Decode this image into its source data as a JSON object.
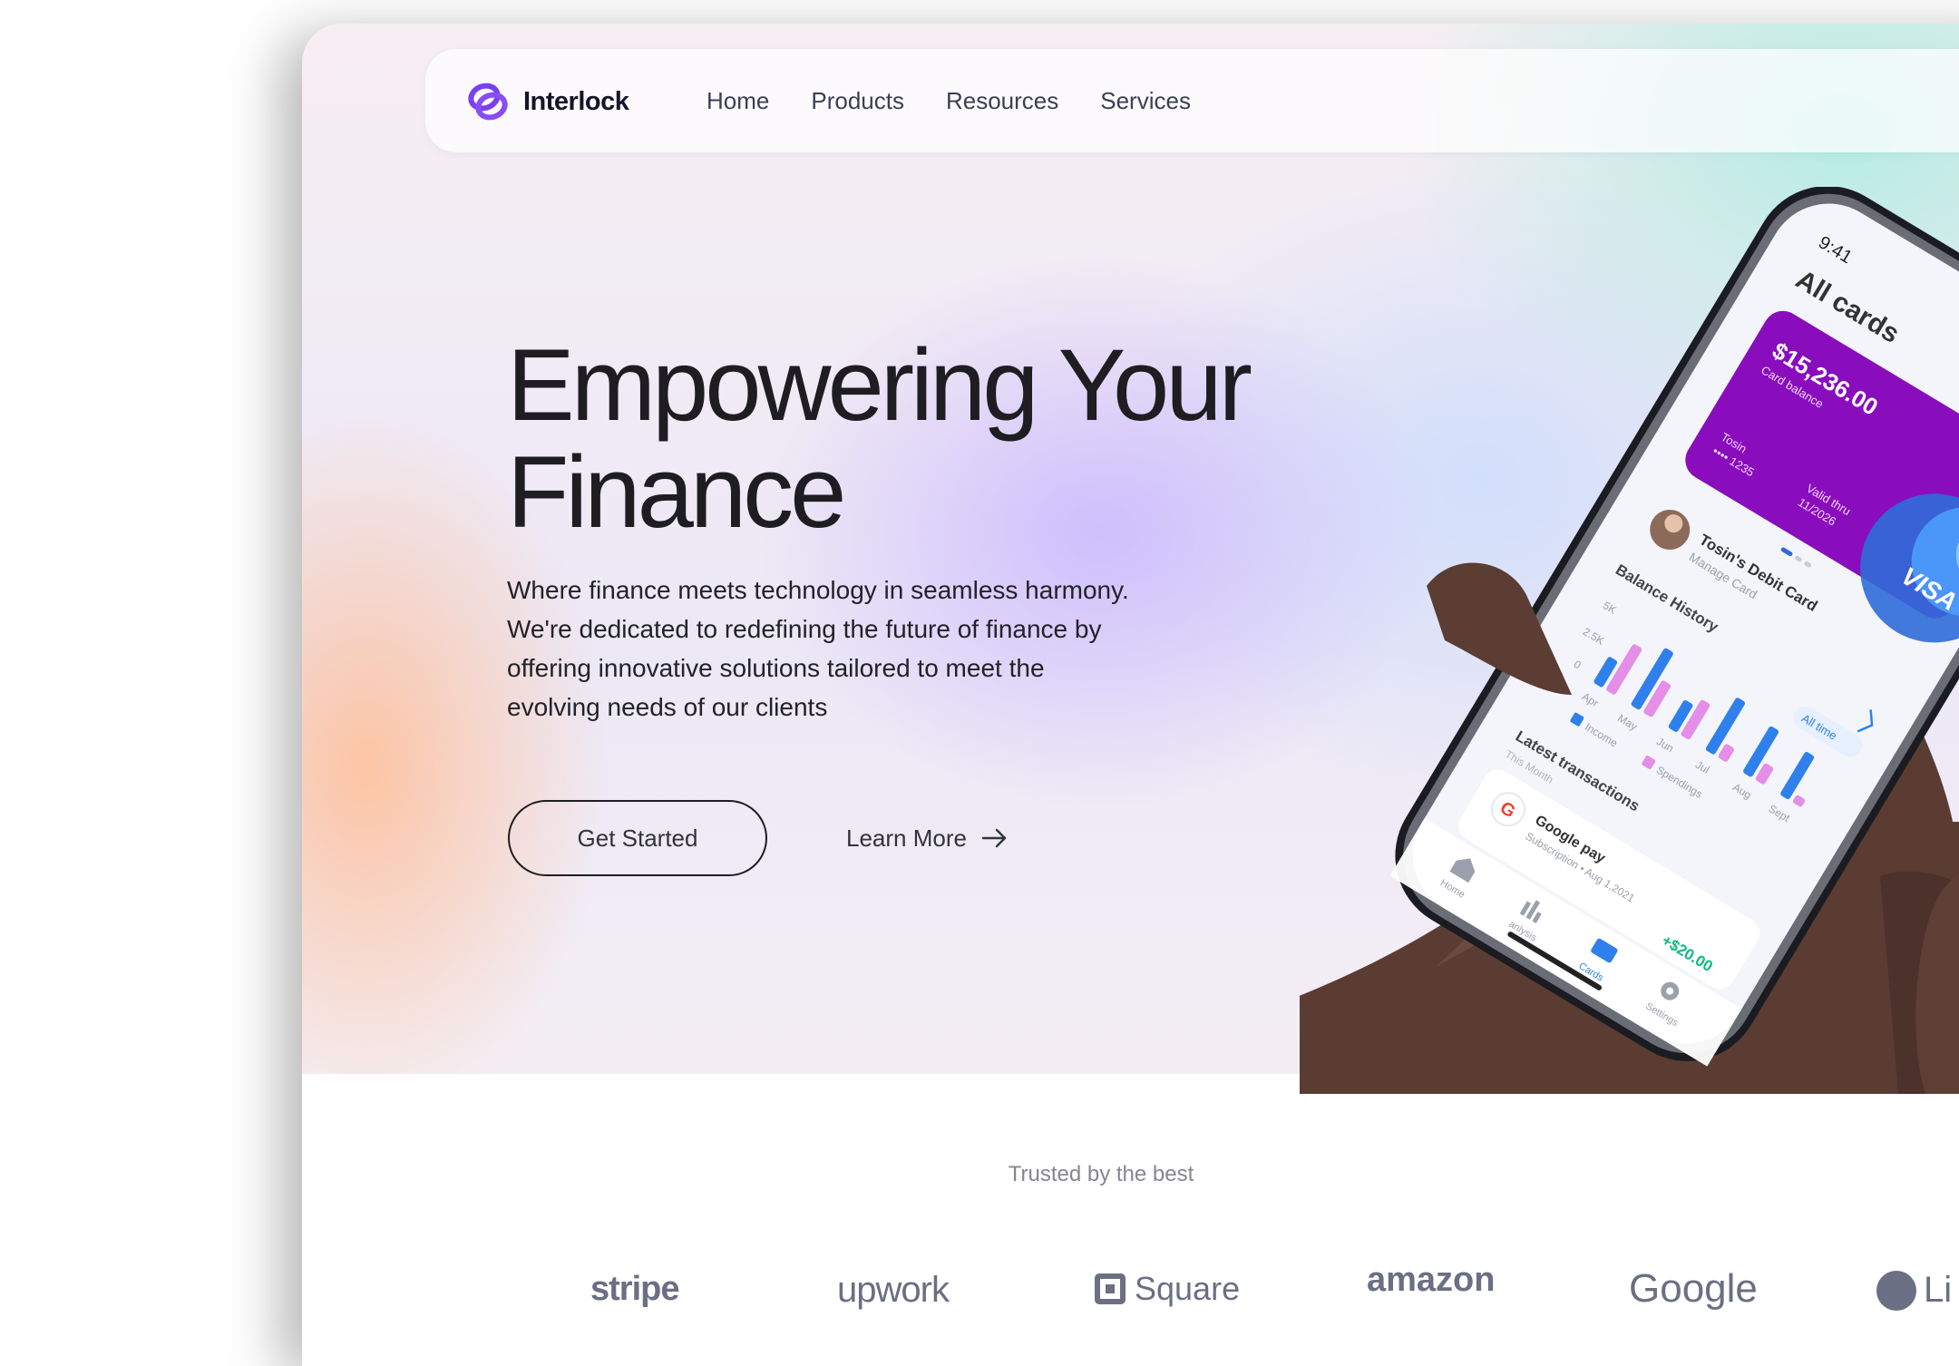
{
  "brand": {
    "name": "Interlock",
    "accent": "#7b3ff2"
  },
  "nav": {
    "links": [
      "Home",
      "Products",
      "Resources",
      "Services"
    ]
  },
  "hero": {
    "headline_line1": "Empowering Your",
    "headline_line2": "Finance",
    "subtext_lines": [
      "Where finance meets technology in seamless harmony.",
      "We're dedicated to redefining the future of finance by",
      "offering innovative solutions tailored to meet the",
      "evolving needs of our clients"
    ],
    "primary_cta": "Get Started",
    "secondary_cta": "Learn More"
  },
  "phone": {
    "time": "9:41",
    "screen_title": "All cards",
    "card_balance": "$15,236.00",
    "card_balance_label": "Card balance",
    "card_network": "VISA",
    "card_holder": "Tosin",
    "card_number": "•••• 1235",
    "card_valid_label": "Valid thru",
    "card_valid": "11/2026",
    "card_name": "Tosin's Debit Card",
    "card_manage": "Manage Card",
    "chart_title": "Balance History",
    "chart_filter": "All time",
    "chart_y_ticks": [
      "5K",
      "2.5K",
      "0"
    ],
    "chart_months": [
      "Apr",
      "May",
      "Jun",
      "Jul",
      "Aug",
      "Sept"
    ],
    "legend": [
      "Income",
      "Spendings"
    ],
    "transactions_title": "Latest transactions",
    "transactions_period": "This Month",
    "transaction_name": "Google pay",
    "transaction_meta": "Subscription • Aug 1,2021",
    "transaction_amount": "+$20.00",
    "tabs": [
      "Home",
      "anlysis",
      "Cards",
      "Settings"
    ]
  },
  "trusted": {
    "label": "Trusted by the best",
    "logos": [
      "stripe",
      "upwork",
      "Square",
      "amazon",
      "Google",
      "Li"
    ]
  }
}
